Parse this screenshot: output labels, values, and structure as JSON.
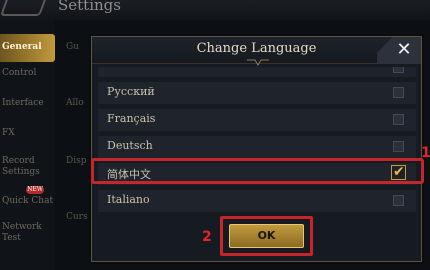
{
  "background": {
    "screen_title": "Settings",
    "sidebar_items": [
      {
        "label": "General",
        "active": true
      },
      {
        "label": "Control",
        "active": false
      },
      {
        "label": "Interface",
        "active": false
      },
      {
        "label": "FX",
        "active": false
      },
      {
        "label": "Record Settings",
        "active": false
      },
      {
        "label": "Quick Chat",
        "active": false
      },
      {
        "label": "Network Test",
        "active": false
      }
    ],
    "quick_chat_badge": "NEW",
    "column_labels": [
      "Gu",
      "Allo",
      "Disp",
      "Curs"
    ]
  },
  "modal": {
    "title": "Change Language",
    "close_glyph": "✕",
    "languages": [
      {
        "label": "Русский",
        "checked": false
      },
      {
        "label": "Français",
        "checked": false
      },
      {
        "label": "Deutsch",
        "checked": false
      },
      {
        "label": "简体中文",
        "checked": true
      },
      {
        "label": "Italiano",
        "checked": false
      }
    ],
    "checkmark_glyph": "✔",
    "ok_label": "OK"
  },
  "annotations": {
    "callout_1": "1",
    "callout_2": "2",
    "highlight_color": "#c8242c"
  },
  "colors": {
    "accent_gold": "#c29a3c",
    "modal_bg": "#161a21",
    "row_bg": "#1f242c"
  }
}
